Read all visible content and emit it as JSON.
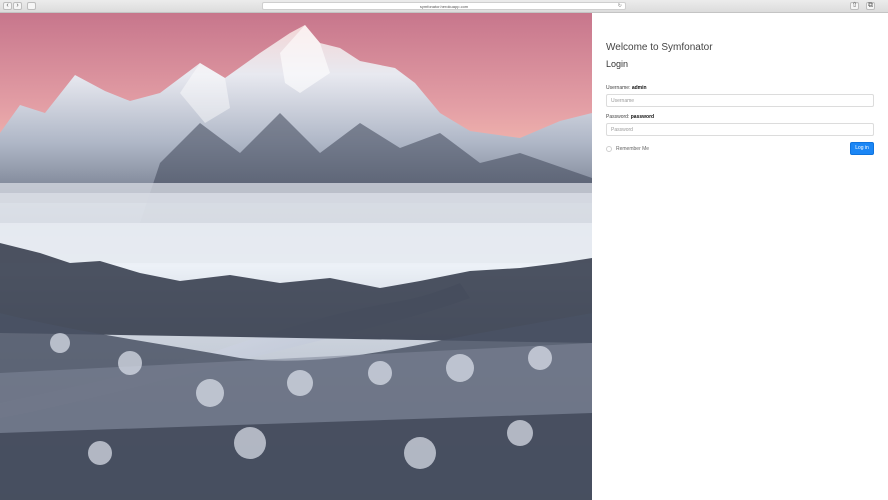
{
  "browser": {
    "url": "symfonator.herokuapp.com"
  },
  "login": {
    "welcome_title": "Welcome to Symfonator",
    "section_title": "Login",
    "username_label": "Username:",
    "username_hint": "admin",
    "username_placeholder": "Username",
    "password_label": "Password:",
    "password_hint": "password",
    "password_placeholder": "Password",
    "remember_me_label": "Remember Me",
    "submit_label": "Log in"
  },
  "colors": {
    "primary_button": "#1b86f5",
    "text_dark": "#333333"
  }
}
